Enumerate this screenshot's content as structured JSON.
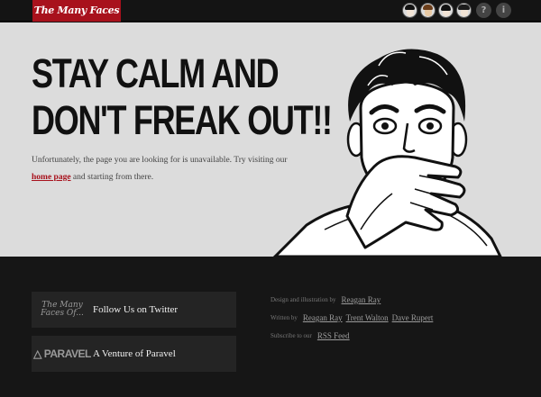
{
  "header": {
    "logo_text": "The Many Faces Of...",
    "avatars": [
      "person-1",
      "person-2",
      "person-3",
      "person-4"
    ],
    "help_label": "?",
    "info_label": "i"
  },
  "hero": {
    "headline_line1": "STAY CALM AND",
    "headline_line2": "DON'T FREAK OUT!!",
    "message_before": "Unfortunately, the page you are looking for is unavailable. Try visiting our ",
    "home_link": "home page",
    "message_after": " and starting from there.",
    "accent_color": "#a8111c"
  },
  "footer": {
    "twitter_logo": "The Many Faces Of...",
    "twitter_label": "Follow Us on Twitter",
    "paravel_logo": "PARAVEL",
    "paravel_label": "A Venture of Paravel",
    "credits": {
      "design_label": "Design and illustration by",
      "design_names": [
        "Reagan Ray"
      ],
      "written_label": "Written by",
      "written_names": [
        "Reagan Ray",
        "Trent Walton",
        "Dave Rupert"
      ],
      "subscribe_label": "Subscribe to our",
      "subscribe_link": "RSS Feed"
    }
  }
}
